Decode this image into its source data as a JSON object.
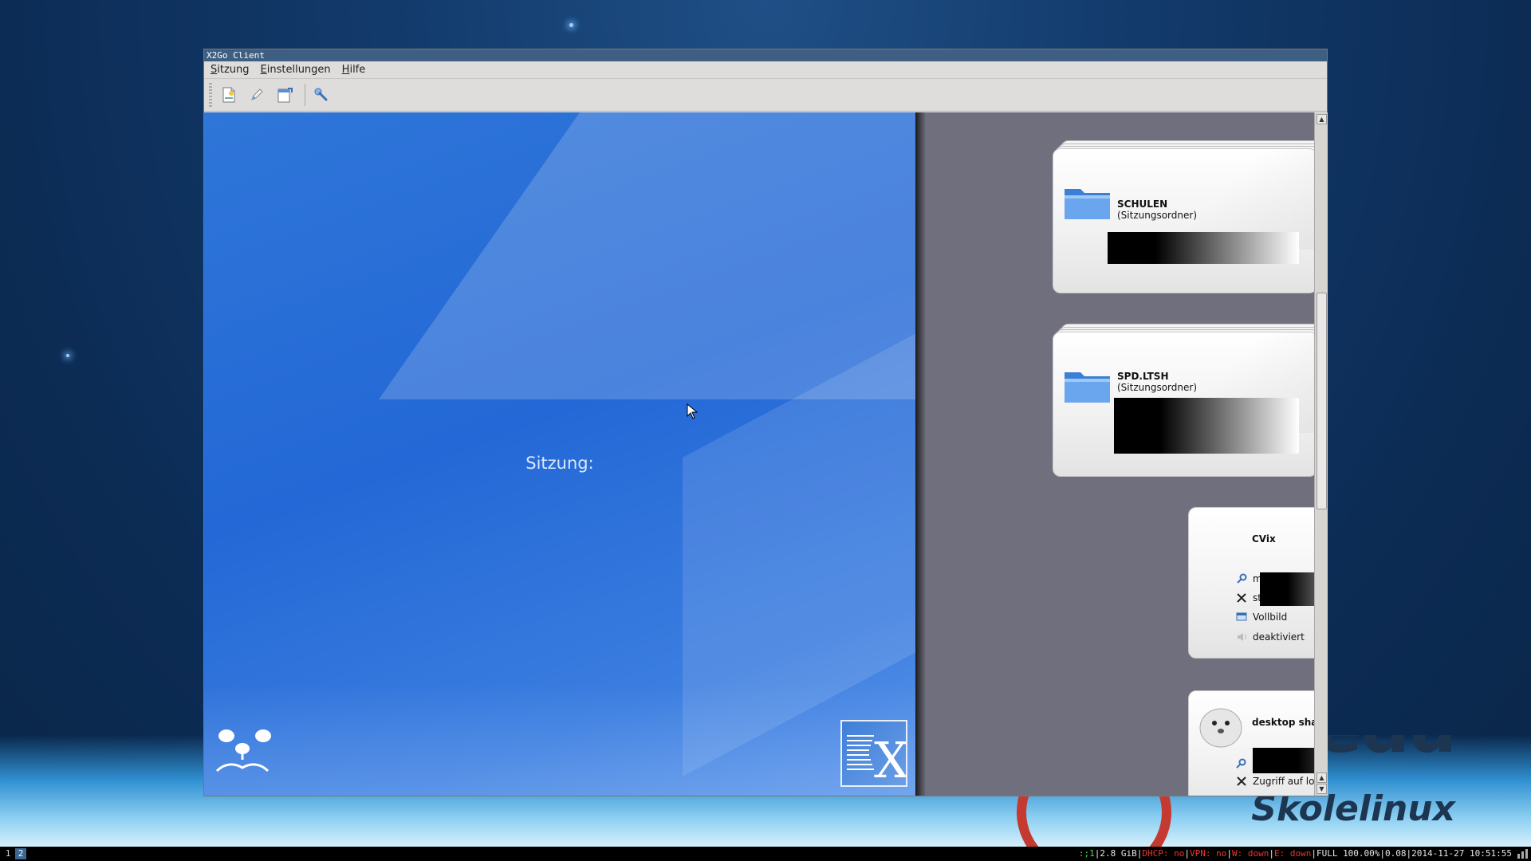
{
  "window": {
    "title": "X2Go Client",
    "menu": [
      {
        "label": "Sitzung",
        "underline": "S",
        "rest": "itzung"
      },
      {
        "label": "Einstellungen",
        "underline": "E",
        "rest": "instellungen"
      },
      {
        "label": "Hilfe",
        "underline": "H",
        "rest": "ilfe"
      }
    ],
    "toolbar": {
      "new_session_icon": "new-session-icon",
      "edit_session_icon": "edit-pencil-icon",
      "export_session_icon": "export-icon",
      "preferences_icon": "wrench-icon"
    },
    "session_label": "Sitzung:"
  },
  "sessions": {
    "folders": [
      {
        "name": "SCHULEN",
        "type": "(Sitzungsordner)"
      },
      {
        "name": "SPD.LTSH",
        "type": "(Sitzungsordner)"
      }
    ],
    "cvix": {
      "name": "CVix",
      "server_prefix": "m",
      "command_prefix": "st",
      "display": "Vollbild",
      "audio": "deaktiviert"
    },
    "desktop_sharing": {
      "name": "desktop sharing",
      "command": "Zugriff auf lokalen Desktop"
    }
  },
  "panel": {
    "workspaces": [
      "1",
      "2"
    ],
    "status": [
      {
        "text": ":;1",
        "color": "#4fd94f"
      },
      {
        "text": "|2.8 GiB|",
        "color": "#e6e6e6"
      },
      {
        "text": "DHCP: no",
        "color": "#e33"
      },
      {
        "text": "|",
        "color": "#e6e6e6"
      },
      {
        "text": "VPN: no",
        "color": "#e33"
      },
      {
        "text": "|",
        "color": "#e6e6e6"
      },
      {
        "text": "W: down",
        "color": "#e33"
      },
      {
        "text": "|",
        "color": "#e6e6e6"
      },
      {
        "text": "E: down",
        "color": "#e33"
      },
      {
        "text": "|FULL 100.00%|0.08|2014-11-27 10:51:55",
        "color": "#e6e6e6"
      }
    ]
  },
  "desktop": {
    "brand_top": "edu",
    "brand_bottom": "Skolelinux"
  }
}
